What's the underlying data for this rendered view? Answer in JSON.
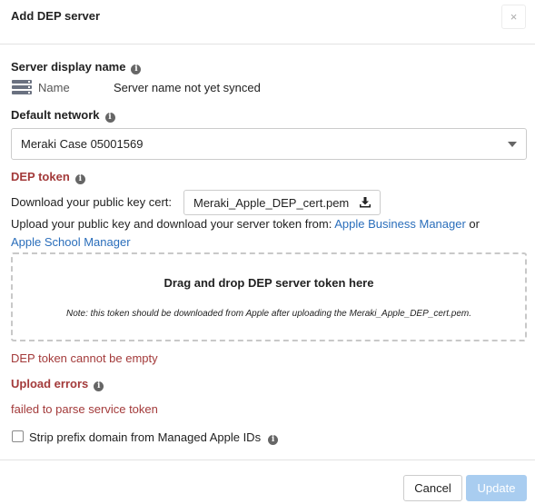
{
  "dialog": {
    "title": "Add DEP server",
    "close_label": "×"
  },
  "server_display_name": {
    "label": "Server display name",
    "field_label": "Name",
    "value": "Server name not yet synced"
  },
  "default_network": {
    "label": "Default network",
    "selected": "Meraki Case 05001569"
  },
  "dep_token": {
    "label": "DEP token",
    "download_text": "Download your public key cert:",
    "cert_filename": "Meraki_Apple_DEP_cert.pem",
    "upload_text": "Upload your public key and download your server token from:",
    "link_business": "Apple Business Manager",
    "or_text": "or",
    "link_school": "Apple School Manager",
    "dropzone_title": "Drag and drop DEP server token here",
    "dropzone_note": "Note: this token should be downloaded from Apple after uploading the Meraki_Apple_DEP_cert.pem.",
    "empty_error": "DEP token cannot be empty"
  },
  "upload_errors": {
    "label": "Upload errors",
    "message": "failed to parse service token"
  },
  "strip_prefix": {
    "label": "Strip prefix domain from Managed Apple IDs",
    "checked": false
  },
  "footer": {
    "cancel_label": "Cancel",
    "update_label": "Update"
  },
  "colors": {
    "error": "#a33a3a",
    "link": "#2a6ebb",
    "primary_disabled": "#a9cdf0"
  }
}
